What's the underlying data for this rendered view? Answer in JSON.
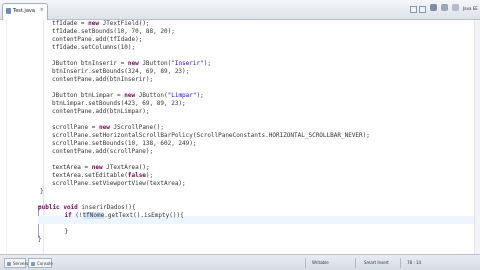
{
  "editor_tab": {
    "label": "Test.java",
    "close": "×"
  },
  "window_right_label": "Java EE",
  "code_lines": [
    {
      "parts": [
        [
          "",
          "tfIdade = "
        ],
        [
          "kw",
          "new"
        ],
        [
          "",
          " JTextField();"
        ]
      ]
    },
    {
      "parts": [
        [
          "",
          "tfIdade.setBounds(10, 70, 88, 20);"
        ]
      ]
    },
    {
      "parts": [
        [
          "",
          "contentPane.add(tfIdade);"
        ]
      ]
    },
    {
      "parts": [
        [
          "",
          "tfIdade.setColumns(10);"
        ]
      ]
    },
    {
      "parts": [
        [
          "",
          ""
        ]
      ]
    },
    {
      "parts": [
        [
          "",
          "JButton btnInserir = "
        ],
        [
          "kw",
          "new"
        ],
        [
          "",
          " JButton("
        ],
        [
          "str",
          "\"Inserir\""
        ],
        [
          "",
          ");"
        ]
      ]
    },
    {
      "parts": [
        [
          "",
          "btnInserir.setBounds(324, 69, 89, 23);"
        ]
      ]
    },
    {
      "parts": [
        [
          "",
          "contentPane.add(btnInserir);"
        ]
      ]
    },
    {
      "parts": [
        [
          "",
          ""
        ]
      ]
    },
    {
      "parts": [
        [
          "",
          "JButton btnLimpar = "
        ],
        [
          "kw",
          "new"
        ],
        [
          "",
          " JButton("
        ],
        [
          "str",
          "\"Limpar\""
        ],
        [
          "",
          ");"
        ]
      ]
    },
    {
      "parts": [
        [
          "",
          "btnLimpar.setBounds(423, 69, 89, 23);"
        ]
      ]
    },
    {
      "parts": [
        [
          "",
          "contentPane.add(btnLimpar);"
        ]
      ]
    },
    {
      "parts": [
        [
          "",
          ""
        ]
      ]
    },
    {
      "parts": [
        [
          "",
          "scrollPane = "
        ],
        [
          "kw",
          "new"
        ],
        [
          "",
          " JScrollPane();"
        ]
      ]
    },
    {
      "parts": [
        [
          "",
          "scrollPane.setHorizontalScrollBarPolicy(ScrollPaneConstants.HORIZONTAL_SCROLLBAR_NEVER);"
        ]
      ]
    },
    {
      "parts": [
        [
          "",
          "scrollPane.setBounds(10, 138, 602, 249);"
        ]
      ]
    },
    {
      "parts": [
        [
          "",
          "contentPane.add(scrollPane);"
        ]
      ]
    },
    {
      "parts": [
        [
          "",
          ""
        ]
      ]
    },
    {
      "parts": [
        [
          "",
          "textArea = "
        ],
        [
          "kw",
          "new"
        ],
        [
          "",
          " JTextArea();"
        ]
      ]
    },
    {
      "parts": [
        [
          "",
          "textArea.setEditable("
        ],
        [
          "kw",
          "false"
        ],
        [
          "",
          ");"
        ]
      ]
    },
    {
      "parts": [
        [
          "",
          "scrollPane.setViewportView(textArea);"
        ]
      ]
    },
    {
      "parts": [
        [
          "",
          "}"
        ]
      ]
    },
    {
      "parts": [
        [
          "",
          ""
        ]
      ]
    },
    {
      "parts": [
        [
          "kw",
          "public"
        ],
        [
          "",
          " "
        ],
        [
          "kw",
          "void"
        ],
        [
          "",
          " inserirDados(){"
        ]
      ]
    },
    {
      "parts": [
        [
          "",
          "    "
        ],
        [
          "kw",
          "if"
        ],
        [
          "",
          " (!"
        ],
        [
          "hl",
          "tfNome"
        ],
        [
          "",
          ".getText().isEmpty()){"
        ]
      ]
    },
    {
      "parts": [
        [
          "",
          ""
        ]
      ]
    },
    {
      "parts": [
        [
          "",
          "    }"
        ]
      ]
    },
    {
      "parts": [
        [
          "",
          "}"
        ]
      ]
    }
  ],
  "bottom_tabs": [
    {
      "label": "Servers"
    },
    {
      "label": "Console"
    }
  ],
  "status": {
    "mode": "Writable",
    "insert": "Smart Insert",
    "position": "78 : 14"
  }
}
